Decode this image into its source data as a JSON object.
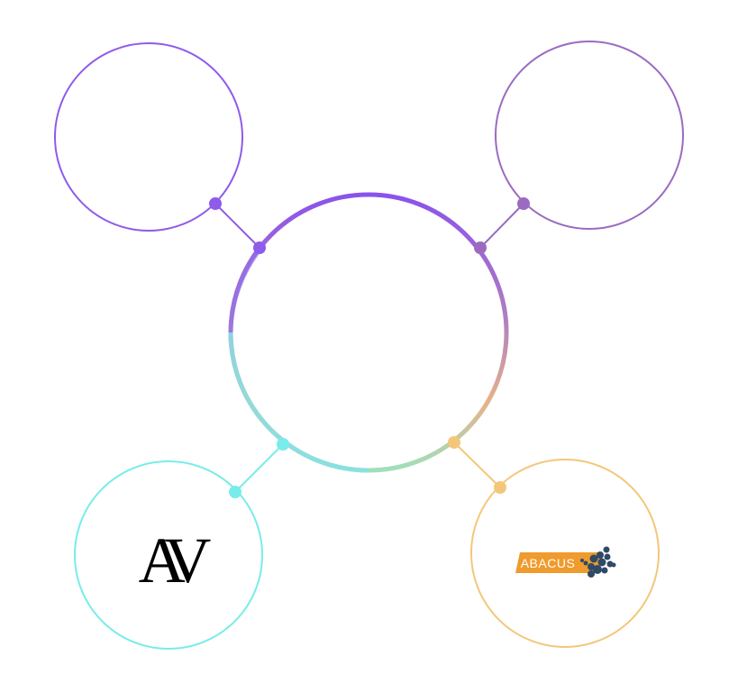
{
  "diagram": {
    "colors": {
      "top_left": "#8f5bea",
      "top_right": "#9a6bc1",
      "bottom_left": "#78ecea",
      "bottom_right": "#f3c77a",
      "center_gradient": [
        "#8a52ec",
        "#c48f9a",
        "#f2b678",
        "#9fe0bb",
        "#7ee2f0"
      ]
    },
    "nodes": {
      "top_left": {
        "label": ""
      },
      "top_right": {
        "label": ""
      },
      "bottom_left": {
        "logo_text": "AV",
        "icon": "av-monogram-logo"
      },
      "bottom_right": {
        "logo_text": "ABACUS",
        "icon": "abacus-logo",
        "logo_bg": "#ef9b2d",
        "dots_color": "#2f4a66"
      }
    }
  }
}
